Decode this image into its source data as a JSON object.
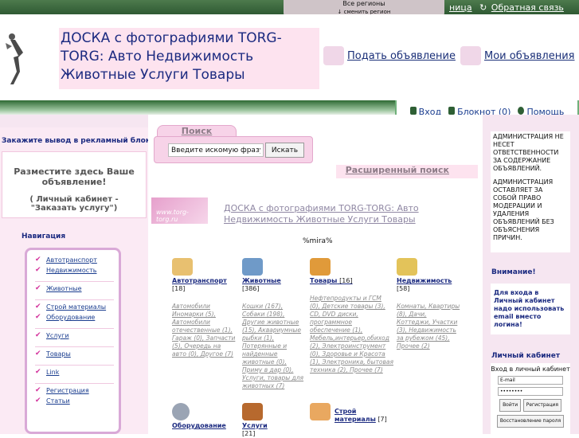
{
  "top": {
    "region_title": "Все регионы",
    "region_change": "↓ сменить регион",
    "link1": "ница",
    "link2": "Обратная связь"
  },
  "header": {
    "title": "ДОСКА с фотографиями TORG-TORG: Авто Недвижимость Животные Услуги Товары",
    "add_ad": "Подать объявление",
    "my_ads": "Мои объявления"
  },
  "userbar": {
    "login": "Вход",
    "notepad": "Блокнот (0)",
    "help": "Помощь"
  },
  "left": {
    "ad_title": "Закажите вывод в рекламный блок",
    "ad_text": "Разместите здесь  Ваше объявление!",
    "ad_text2": "( Личный кабинет - \"Заказать услугу\")",
    "nav_title": "Навигация",
    "nav": [
      "Автотранспорт",
      "Недвижимость",
      "Животные",
      "Строй материалы",
      "Оборудование",
      "Услуги",
      "Товары",
      "Link",
      "Регистрация",
      "Статьи"
    ]
  },
  "search": {
    "tab": "Поиск",
    "placeholder": "Введите искомую фразу",
    "button": "Искать",
    "advanced": "Расширенный поиск"
  },
  "site": {
    "logo": "www.torg-torg.ru",
    "link": "ДОСКА с фотографиями TORG-TORG: Авто Недвижимость Животные Услуги Товары",
    "mira": "%mira%"
  },
  "categories": [
    {
      "name": "Автотранспорт",
      "count": "[18]",
      "sub": "Автомобили Иномарки (5), Автомобили отечественные (1), Гараж (0), Запчасти (5), Очередь на авто (0), Другое (7)"
    },
    {
      "name": "Животные",
      "count": "[386]",
      "sub": "Кошки (167), Собаки (198), Другие животные (15), Аквариумные рыбки (1), Потерянные и найденные животные (0), Приму в дар (0), Услуги, товары для животных (7)"
    },
    {
      "name": "Товары",
      "count": "[16]",
      "sub": "Нефтепродукты и ГСМ (0), Детские товары (3), CD, DVD диски, программное обеспечение (1), Мебель,интерьер,обиход (2), Электроинструмент (0), Здоровье и Красота (1), Электроника, бытовая техника (2), Прочее (7)"
    },
    {
      "name": "Недвижимость",
      "count": "[58]",
      "sub": "Комнаты, Квартиры (8), Дачи, Коттеджи, Участки (3), Недвижимость за рубежом (45), Прочее (2)"
    },
    {
      "name": "Оборудование",
      "count": "",
      "sub": ""
    },
    {
      "name": "Услуги",
      "count": "[21]",
      "sub": ""
    },
    {
      "name": "Строй материалы",
      "count": "[7]",
      "sub": ""
    }
  ],
  "right": {
    "disclaimer1": "АДМИНИСТРАЦИЯ НЕ НЕСЕТ ОТВЕТСТВЕННОСТИ ЗА СОДЕРЖАНИЕ ОБЪЯВЛЕНИЙ.",
    "disclaimer2": "АДМИНИСТРАЦИЯ ОСТАВЛЯЕТ ЗА СОБОЙ ПРАВО МОДЕРАЦИИ И УДАЛЕНИЯ ОБЪЯВЛЕНИЙ БЕЗ ОБЪЯСНЕНИЯ ПРИЧИН.",
    "attention_title": "Внимание!",
    "attention_text": "Для входа в Личный кабинет надо использовать email вместо логина!",
    "cabinet_title": "Личный кабинет",
    "cabinet_text": "Вход в личный кабинет",
    "email_placeholder": "E-mail",
    "password_value": "••••••••",
    "login_btn": "Войти",
    "register_btn": "Регистрация",
    "recover_btn": "Восстановление пароля"
  },
  "colors": {
    "accent": "#1b2a80",
    "pink": "#fde3ef",
    "green": "#2f6a34"
  }
}
